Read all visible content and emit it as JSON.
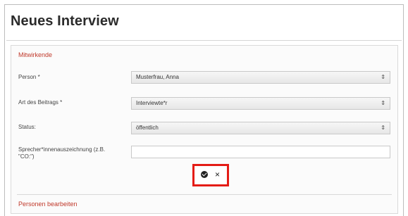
{
  "page": {
    "title": "Neues Interview"
  },
  "sections": {
    "contributors": "Mitwirkende",
    "edit_persons": "Personen bearbeiten"
  },
  "fields": [
    {
      "label": "Person *",
      "value": "Musterfrau, Anna"
    },
    {
      "label": "Art des Beitrags *",
      "value": "Interviewte*r"
    },
    {
      "label": "Status:",
      "value": "öffentlich"
    },
    {
      "label": "Sprecher*innenauszeichnung (z.B. \"CO:\")",
      "value": ""
    }
  ],
  "actions": {
    "confirm_icon": "check-circle-icon",
    "cancel_glyph": "×"
  },
  "colors": {
    "section_heading": "#c0392b",
    "highlight_border": "#e41c16"
  }
}
